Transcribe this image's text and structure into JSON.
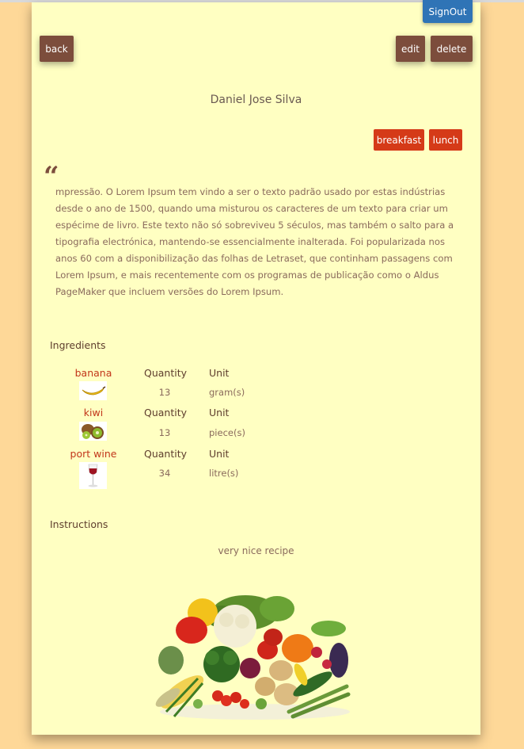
{
  "header": {
    "signout_label": "SignOut"
  },
  "actions": {
    "back_label": "back",
    "edit_label": "edit",
    "delete_label": "delete"
  },
  "recipe": {
    "author": "Daniel Jose Silva",
    "tags": [
      "breakfast",
      "lunch"
    ],
    "description": "mpressão. O Lorem Ipsum tem vindo a ser o texto padrão usado por estas indústrias desde o ano de 1500, quando uma misturou os caracteres de um texto para criar um espécime de livro. Este texto não só sobreviveu 5 séculos, mas também o salto para a tipografia electrónica, mantendo-se essencialmente inalterada. Foi popularizada nos anos 60 com a disponibilização das folhas de Letraset, que continham passagens com Lorem Ipsum, e mais recentemente com os programas de publicação como o Aldus PageMaker que incluem versões do Lorem Ipsum.",
    "ingredients_heading": "Ingredients",
    "quantity_header": "Quantity",
    "unit_header": "Unit",
    "ingredients": [
      {
        "name": "banana",
        "quantity": "13",
        "unit": "gram(s)",
        "icon": "banana-icon"
      },
      {
        "name": "kiwi",
        "quantity": "13",
        "unit": "piece(s)",
        "icon": "kiwi-icon"
      },
      {
        "name": "port wine",
        "quantity": "34",
        "unit": "litre(s)",
        "icon": "wine-glass-icon"
      }
    ],
    "instructions_heading": "Instructions",
    "instructions": "very nice recipe"
  },
  "colors": {
    "page_bg": "#fed898",
    "card_bg": "#ffffc2",
    "brown_button": "#7c4d3c",
    "red_tag": "#d53a18",
    "blue_button": "#2f74b6"
  }
}
